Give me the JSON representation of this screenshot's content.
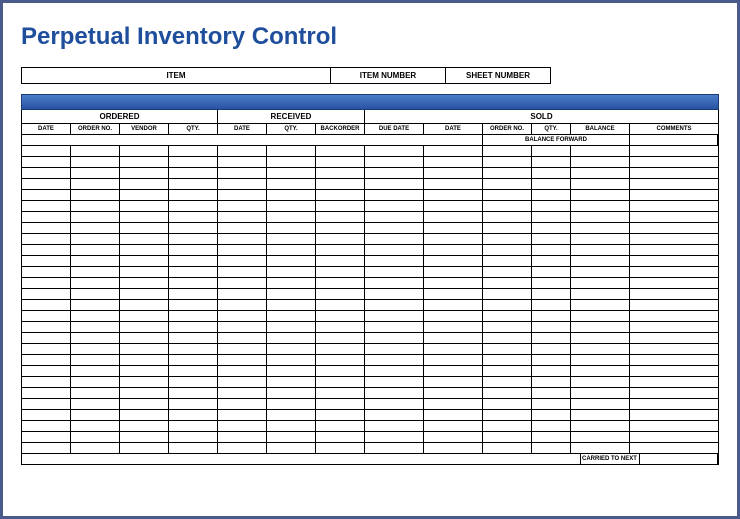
{
  "title": "Perpetual Inventory Control",
  "top_boxes": {
    "item": "ITEM",
    "item_number": "ITEM NUMBER",
    "sheet_number": "SHEET NUMBER"
  },
  "sections": {
    "ordered": "ORDERED",
    "received": "RECEIVED",
    "sold": "SOLD"
  },
  "columns": {
    "date1": "DATE",
    "orderno": "ORDER NO.",
    "vendor": "VENDOR",
    "qty1": "QTY.",
    "date2": "DATE",
    "qty2": "QTY.",
    "backorder": "BACKORDER",
    "duedate": "DUE DATE",
    "date3": "DATE",
    "orderno2": "ORDER NO.",
    "qty3": "QTY.",
    "balance": "BALANCE",
    "comments": "COMMENTS"
  },
  "balance_forward": "BALANCE FORWARD",
  "footer": "CARRIED TO NEXT SHEET",
  "data_row_count": 28
}
